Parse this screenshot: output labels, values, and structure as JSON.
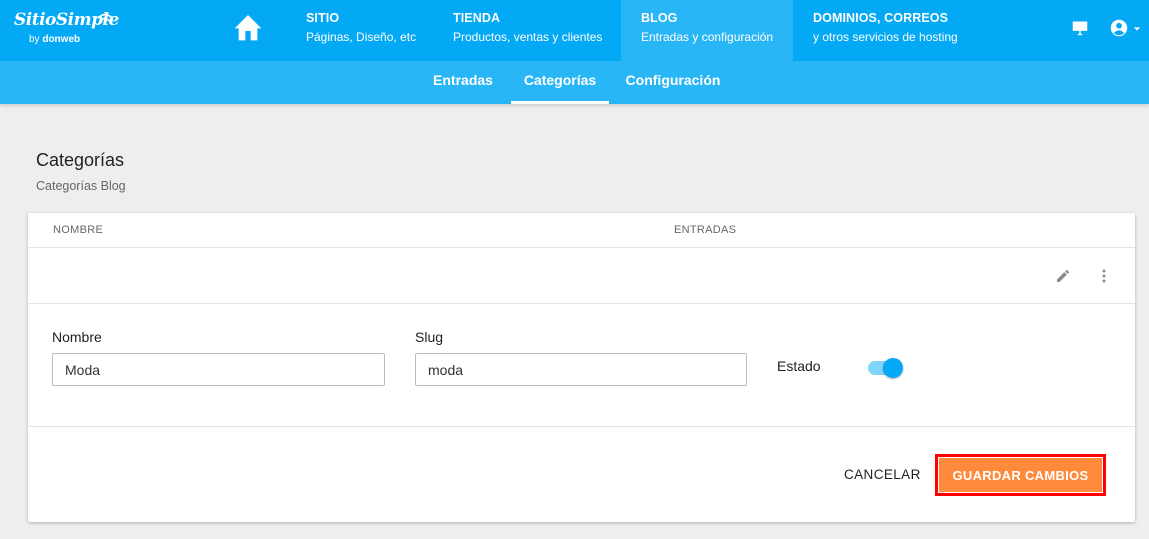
{
  "brand": {
    "name": "SitioSimple",
    "by": "by",
    "company": "donweb"
  },
  "nav": [
    {
      "title": "SITIO",
      "subtitle": "Páginas, Diseño, etc"
    },
    {
      "title": "TIENDA",
      "subtitle": "Productos, ventas y clientes"
    },
    {
      "title": "BLOG",
      "subtitle": "Entradas y configuración"
    },
    {
      "title": "DOMINIOS, CORREOS",
      "subtitle": "y otros servicios de hosting"
    }
  ],
  "subnav": {
    "tabs": [
      "Entradas",
      "Categorías",
      "Configuración"
    ],
    "active": "Categorías"
  },
  "page": {
    "title": "Categorías",
    "subtitle": "Categorías Blog"
  },
  "table": {
    "columns": [
      "NOMBRE",
      "ENTRADAS"
    ]
  },
  "form": {
    "nombre_label": "Nombre",
    "nombre_value": "Moda",
    "slug_label": "Slug",
    "slug_value": "moda",
    "estado_label": "Estado",
    "estado_on": true
  },
  "actions": {
    "cancel": "CANCELAR",
    "save": "GUARDAR CAMBIOS"
  },
  "icons": [
    "home-icon",
    "monitor-icon",
    "account-icon",
    "chevron-down-icon",
    "pencil-icon",
    "more-vert-icon",
    "wifi-icon"
  ],
  "colors": {
    "primary": "#03a9f4",
    "subbar": "#29b6f6",
    "save": "#ff8a3c",
    "highlight": "#ff0000"
  }
}
